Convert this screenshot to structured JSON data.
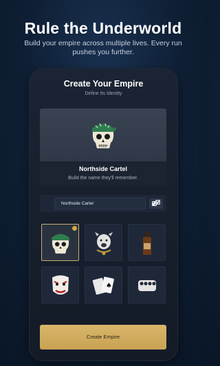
{
  "headline": "Rule the Underworld",
  "subheadline": "Build your empire across multiple lives. Every run pushes you further.",
  "panel": {
    "title": "Create Your Empire",
    "subtitle": "Define Its Identity"
  },
  "preview": {
    "empire_name": "Northside Cartel",
    "tagline": "Build the name they'll remember.",
    "emblem_icon": "skull-bandana-icon"
  },
  "name_field": {
    "value": "Northside Cartel",
    "randomize_icon": "dice-icon"
  },
  "emblems": [
    {
      "icon": "skull-bandana-icon",
      "selected": true
    },
    {
      "icon": "bulldog-chain-icon",
      "selected": false
    },
    {
      "icon": "bottle-icon",
      "selected": false
    },
    {
      "icon": "clown-mask-icon",
      "selected": false
    },
    {
      "icon": "playing-cards-icon",
      "selected": false
    },
    {
      "icon": "brass-knuckles-icon",
      "selected": false
    }
  ],
  "create_button": "Create Empire",
  "colors": {
    "accent_gold": "#d4b067",
    "bandana_green": "#2f7d4e",
    "background": "#0f1f35"
  }
}
